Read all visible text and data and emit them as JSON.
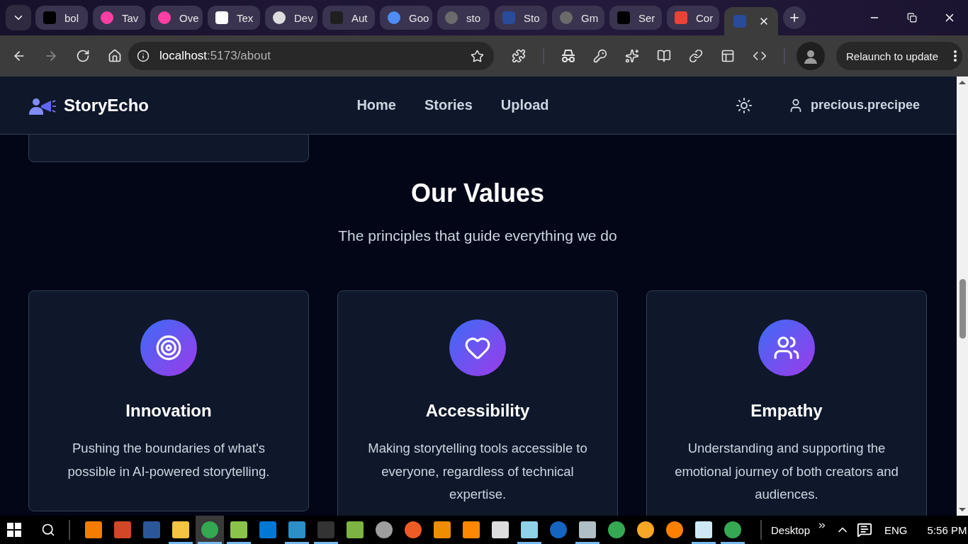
{
  "browser": {
    "tabs": [
      {
        "label": "bol",
        "color": "#000000",
        "kind": "square",
        "selected": false
      },
      {
        "label": "Tav",
        "color": "#ff3fa4",
        "kind": "round",
        "selected": false
      },
      {
        "label": "Ove",
        "color": "#ff3fa4",
        "kind": "round",
        "selected": false
      },
      {
        "label": "Tex",
        "color": "#ffffff",
        "kind": "square",
        "selected": false
      },
      {
        "label": "Dev",
        "color": "#dddddd",
        "kind": "round",
        "selected": false
      },
      {
        "label": "Aut",
        "color": "#1f1f1f",
        "kind": "square",
        "selected": false
      },
      {
        "label": "Goo",
        "color": "#4e8cf7",
        "kind": "round",
        "selected": false
      },
      {
        "label": "sto",
        "color": "#6b6b6b",
        "kind": "round",
        "selected": false
      },
      {
        "label": "Sto",
        "color": "#2a4a9a",
        "kind": "square",
        "selected": false
      },
      {
        "label": "Gm",
        "color": "#6b6b6b",
        "kind": "round",
        "selected": false
      },
      {
        "label": "Ser",
        "color": "#000000",
        "kind": "square",
        "selected": false
      },
      {
        "label": "Cor",
        "color": "#ea4335",
        "kind": "square",
        "selected": false
      },
      {
        "color": "#2a4a9a",
        "kind": "square",
        "selected": true
      }
    ],
    "nav": [
      {
        "kind": "back",
        "disabled": false
      },
      {
        "kind": "forward",
        "disabled": true
      },
      {
        "kind": "reload",
        "disabled": false
      },
      {
        "kind": "home",
        "disabled": false
      }
    ],
    "address": {
      "host": "localhost",
      "path": ":5173/about"
    },
    "relaunch": "Relaunch to update"
  },
  "header": {
    "brand": "StoryEcho",
    "links": [
      "Home",
      "Stories",
      "Upload"
    ],
    "user": "precious.precipee"
  },
  "intro_card": {
    "kind": "card"
  },
  "values": {
    "title": "Our Values",
    "subtitle": "The principles that guide everything we do",
    "cards": [
      {
        "title": "Innovation",
        "text": "Pushing the boundaries of what's possible in AI-powered storytelling."
      },
      {
        "title": "Accessibility",
        "text": "Making storytelling tools accessible to everyone, regardless of technical expertise."
      },
      {
        "title": "Empathy",
        "text": "Understanding and supporting the emotional journey of both creators and audiences."
      }
    ]
  },
  "taskbar": {
    "apps": [
      {
        "kind": "square",
        "color": "#f57c00",
        "running": false,
        "selected": false
      },
      {
        "kind": "square",
        "color": "#d24726",
        "running": false,
        "selected": false
      },
      {
        "kind": "square",
        "color": "#2b579a",
        "running": false,
        "selected": false
      },
      {
        "kind": "square",
        "color": "#f4c542",
        "running": true,
        "selected": false
      },
      {
        "kind": "round",
        "color": "#34a853",
        "running": true,
        "selected": true
      },
      {
        "kind": "square",
        "color": "#8bc34a",
        "running": true,
        "selected": false
      },
      {
        "kind": "square",
        "color": "#0078d4",
        "running": false,
        "selected": false
      },
      {
        "kind": "square",
        "color": "#2c8fc6",
        "running": true,
        "selected": false
      },
      {
        "kind": "square",
        "color": "#333333",
        "running": true,
        "selected": false
      },
      {
        "kind": "square",
        "color": "#7cb342",
        "running": false,
        "selected": false
      },
      {
        "kind": "round",
        "color": "#9e9e9e",
        "running": false,
        "selected": false
      },
      {
        "kind": "round",
        "color": "#ef5b25",
        "running": false,
        "selected": false
      },
      {
        "kind": "square",
        "color": "#f08c00",
        "running": false,
        "selected": false
      },
      {
        "kind": "square",
        "color": "#ff8800",
        "running": false,
        "selected": false
      },
      {
        "kind": "square",
        "color": "#dddddd",
        "running": false,
        "selected": false
      },
      {
        "kind": "square",
        "color": "#8fd3e8",
        "running": true,
        "selected": false
      },
      {
        "kind": "round",
        "color": "#1565c0",
        "running": false,
        "selected": false
      },
      {
        "kind": "square",
        "color": "#b0bec5",
        "running": true,
        "selected": false
      },
      {
        "kind": "round",
        "color": "#34a853",
        "running": false,
        "selected": false
      },
      {
        "kind": "round",
        "color": "#f9a825",
        "running": false,
        "selected": false
      },
      {
        "kind": "round",
        "color": "#ff7f00",
        "running": false,
        "selected": false
      },
      {
        "kind": "square",
        "color": "#cfe8f5",
        "running": true,
        "selected": false
      },
      {
        "kind": "round",
        "color": "#34a853",
        "running": true,
        "selected": false
      }
    ],
    "desktop": "Desktop",
    "language": "ENG",
    "time": "5:56 PM"
  }
}
